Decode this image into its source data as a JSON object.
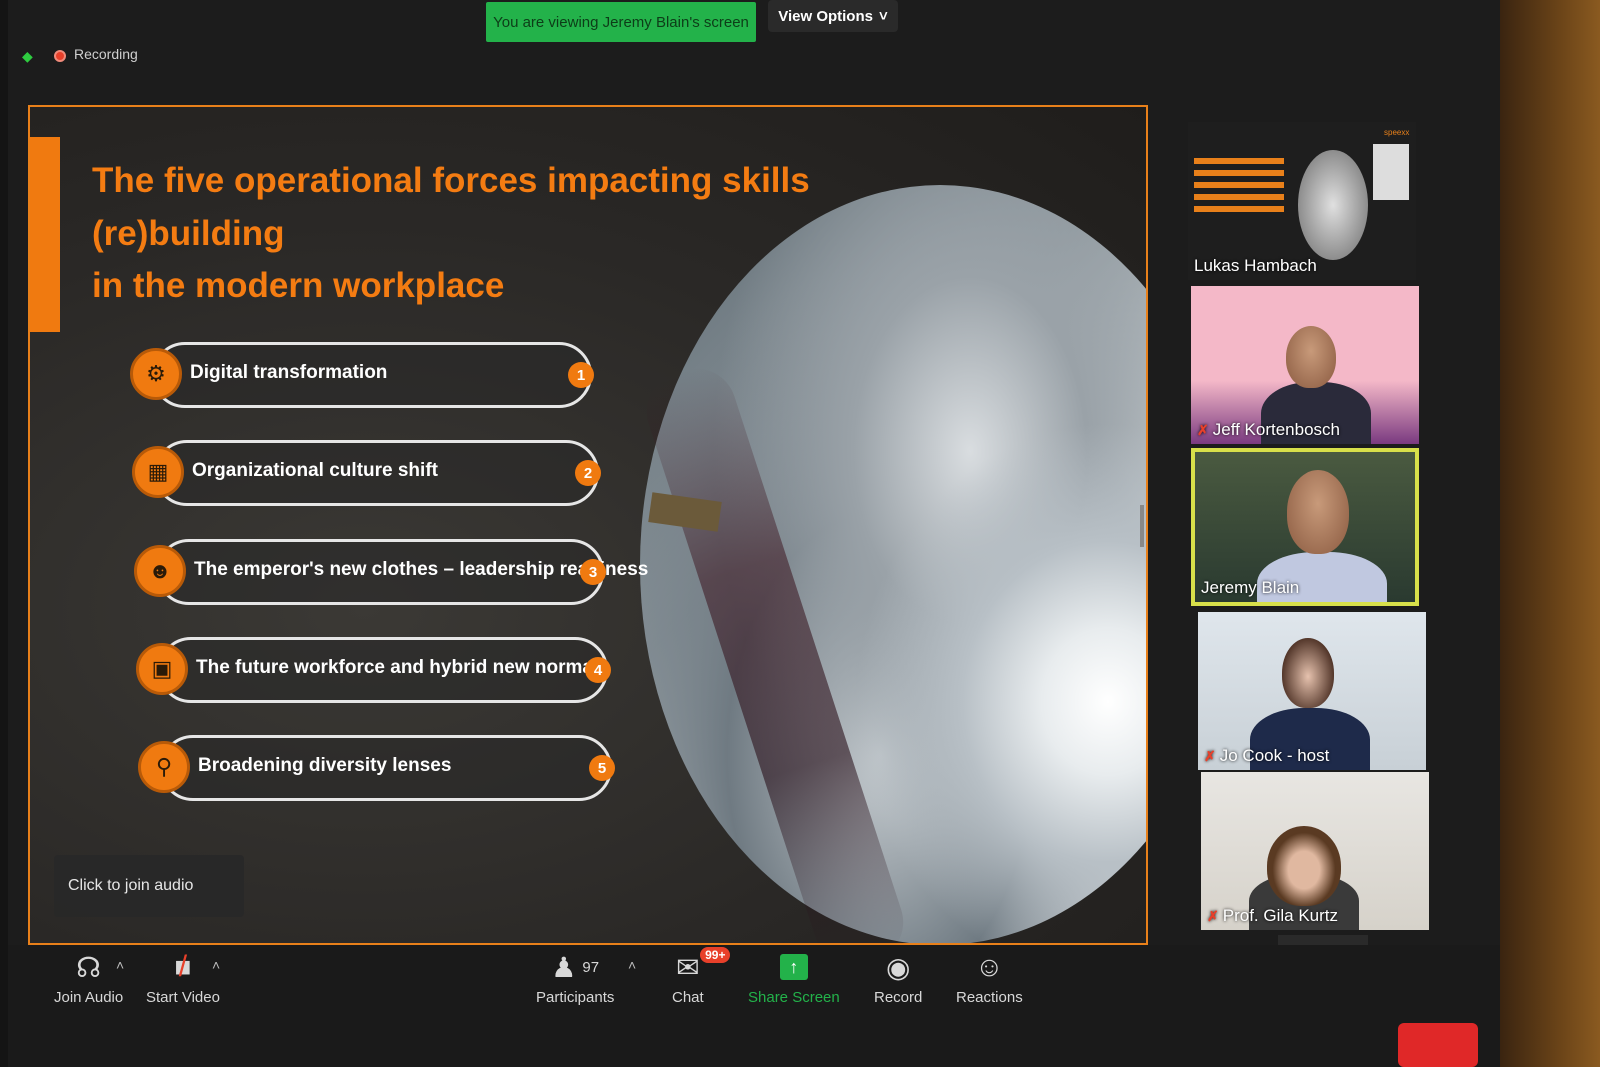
{
  "window": {
    "recording_label": "Recording",
    "viewing_banner": "You are viewing Jeremy Blain's screen",
    "view_options_label": "View Options"
  },
  "slide": {
    "title_line1": "The five operational forces impacting skills (re)building",
    "title_line2": "in the modern workplace",
    "forces": [
      {
        "label": "Digital transformation",
        "number": "1",
        "icon": "gears-people-icon"
      },
      {
        "label": "Organizational culture shift",
        "number": "2",
        "icon": "building-icon"
      },
      {
        "label": "The emperor's new clothes – leadership readiness",
        "number": "3",
        "icon": "group-icon"
      },
      {
        "label": "The future workforce and hybrid new normal",
        "number": "4",
        "icon": "monitor-icon"
      },
      {
        "label": "Broadening diversity lenses",
        "number": "5",
        "icon": "magnifier-icon"
      }
    ],
    "accent_color": "#f07a10"
  },
  "join_audio_tip": "Click to join audio",
  "participants": [
    {
      "name": "Lukas Hambach",
      "muted": false
    },
    {
      "name": "Jeff Kortenbosch",
      "muted": true
    },
    {
      "name": "Jeremy Blain",
      "muted": false,
      "active_speaker": true
    },
    {
      "name": "Jo Cook - host",
      "muted": true
    },
    {
      "name": "Prof. Gila Kurtz",
      "muted": true
    }
  ],
  "thumbnail_brand": "speexx",
  "toolbar": {
    "join_audio": "Join Audio",
    "start_video": "Start Video",
    "participants_label": "Participants",
    "participants_count": "97",
    "chat_label": "Chat",
    "chat_badge": "99+",
    "share_screen_label": "Share Screen",
    "record_label": "Record",
    "reactions_label": "Reactions"
  },
  "colors": {
    "banner_green": "#23b24a",
    "active_speaker_border": "#d8e04a",
    "leave_red": "#e02828"
  }
}
